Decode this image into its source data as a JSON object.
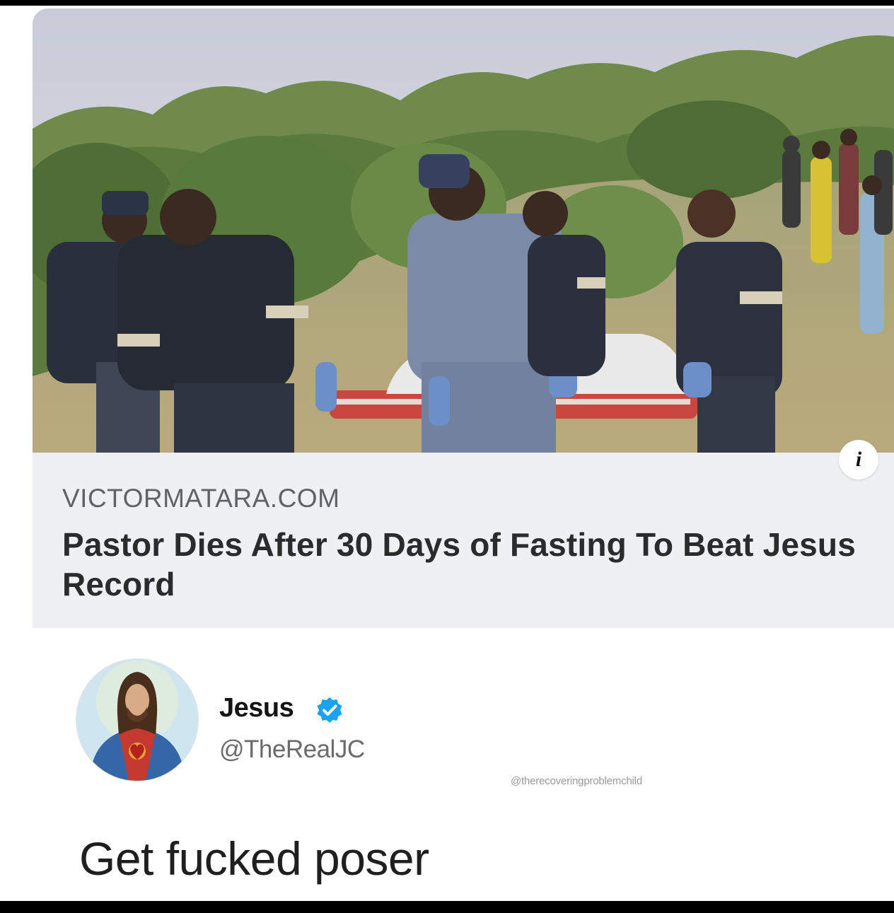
{
  "card": {
    "domain": "VICTORMATARA.COM",
    "headline": "Pastor Dies After 30 Days of Fasting To Beat Jesus Record",
    "info_icon": "info-icon",
    "photo": "photo of uniformed officers carrying a covered stretcher through bushland"
  },
  "tweet": {
    "display_name": "Jesus",
    "verified_icon": "verified-badge-icon",
    "handle": "@TheRealJC",
    "watermark": "@therecoveringproblemchild",
    "text": "Get fucked poser"
  },
  "colors": {
    "verified_blue": "#1da1f2",
    "card_background": "#eff0f3",
    "page_background": "#ffffff",
    "border_bars": "#000000"
  }
}
